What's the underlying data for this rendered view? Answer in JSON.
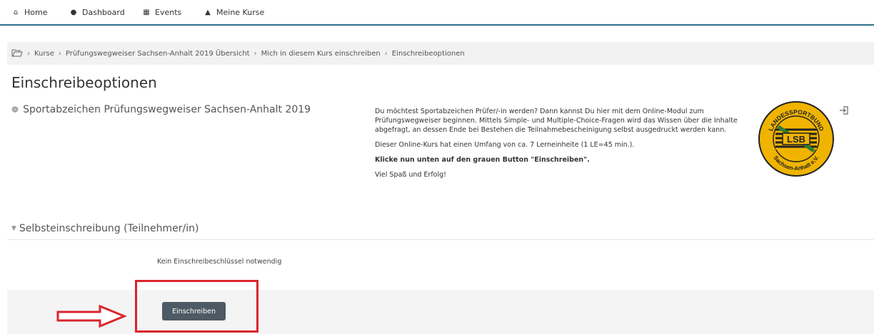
{
  "nav": {
    "items": [
      {
        "label": "Home",
        "icon": "home-icon"
      },
      {
        "label": "Dashboard",
        "icon": "dashboard-icon"
      },
      {
        "label": "Events",
        "icon": "calendar-icon"
      },
      {
        "label": "Meine Kurse",
        "icon": "graduation-cap-icon"
      }
    ]
  },
  "breadcrumb": {
    "items": [
      "Kurse",
      "Prüfungswegweiser Sachsen-Anhalt 2019 Übersicht",
      "Mich in diesem Kurs einschreiben",
      "Einschreibeoptionen"
    ]
  },
  "page": {
    "title": "Einschreibeoptionen"
  },
  "course": {
    "name": "Sportabzeichen Prüfungswegweiser Sachsen-Anhalt 2019",
    "summary": [
      "Du möchtest  Sportabzeichen Prüfer/-in werden? Dann kannst Du hier mit dem Online-Modul zum Prüfungswegweiser beginnen. Mittels Simple- und Multiple-Choice-Fragen wird das Wissen über die Inhalte abgefragt, an dessen Ende bei Bestehen die Teilnahmebescheinigung selbst ausgedruckt werden kann.",
      "Dieser Online-Kurs hat einen Umfang von ca. 7 Lerneinheite (1 LE=45 min.).",
      "Klicke nun unten auf den grauen Button \"Einschreiben\".",
      "Viel Spaß und Erfolg!"
    ],
    "logo": {
      "text_top": "LANDESSPORTBUND",
      "text_center": "LSB",
      "text_bottom": "Sachsen-Anhalt e.V."
    }
  },
  "self_enrolment": {
    "section_title": "Selbsteinschreibung (Teilnehmer/in)",
    "no_key_text": "Kein Einschreibeschlüssel notwendig",
    "button_label": "Einschreiben"
  },
  "colors": {
    "nav_underline": "#2f6f8f",
    "button_bg": "#4d5a63",
    "annotation_red": "#d9262b",
    "logo_yellow": "#f0b400"
  }
}
